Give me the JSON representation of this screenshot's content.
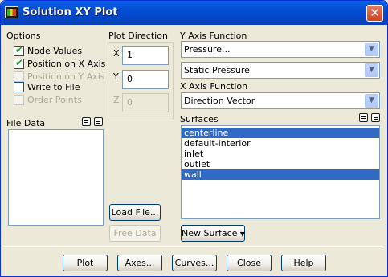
{
  "window": {
    "title": "Solution XY Plot",
    "close_glyph": "✕"
  },
  "options": {
    "heading": "Options",
    "items": [
      {
        "label": "Node Values",
        "checked": true,
        "enabled": true
      },
      {
        "label": "Position on X Axis",
        "checked": true,
        "enabled": true
      },
      {
        "label": "Position on Y Axis",
        "checked": false,
        "enabled": false
      },
      {
        "label": "Write to File",
        "checked": false,
        "enabled": true
      },
      {
        "label": "Order Points",
        "checked": false,
        "enabled": false
      }
    ]
  },
  "plot_direction": {
    "heading": "Plot Direction",
    "x": {
      "label": "X",
      "value": "1"
    },
    "y": {
      "label": "Y",
      "value": "0"
    },
    "z": {
      "label": "Z",
      "value": "0"
    }
  },
  "y_axis": {
    "heading": "Y Axis Function",
    "category": "Pressure...",
    "quantity": "Static Pressure"
  },
  "x_axis": {
    "heading": "X Axis Function",
    "value": "Direction Vector"
  },
  "file_data": {
    "heading": "File Data",
    "items": []
  },
  "surfaces": {
    "heading": "Surfaces",
    "items": [
      {
        "label": "centerline",
        "selected": true
      },
      {
        "label": "default-interior",
        "selected": false
      },
      {
        "label": "inlet",
        "selected": false
      },
      {
        "label": "outlet",
        "selected": false
      },
      {
        "label": "wall",
        "selected": true
      }
    ]
  },
  "buttons": {
    "load_file": "Load File...",
    "free_data": "Free Data",
    "new_surface": "New Surface",
    "plot": "Plot",
    "axes": "Axes...",
    "curves": "Curves...",
    "close": "Close",
    "help": "Help"
  },
  "colors": {
    "title_bar": "#0450d4",
    "selection": "#316ac5",
    "dialog_bg": "#ece9d8"
  }
}
